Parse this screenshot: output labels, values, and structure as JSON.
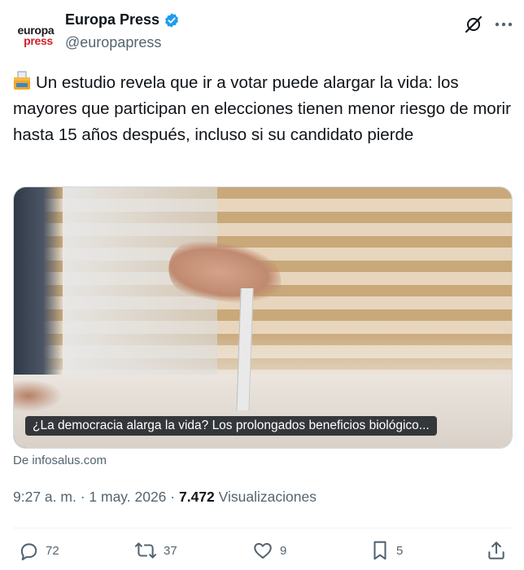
{
  "author": {
    "display_name": "Europa Press",
    "handle": "@europapress",
    "avatar_line1": "europa",
    "avatar_line2": "press",
    "verified": true
  },
  "tweet": {
    "text": "Un estudio revela que ir a votar puede alargar la vida: los mayores que participan en elecciones tienen menor riesgo de morir hasta 15 años después, incluso si su candidato pierde",
    "leading_icon": "ballot-box-icon"
  },
  "media": {
    "caption": "¿La democracia alarga la vida? Los prolongados beneficios biológico..."
  },
  "source": {
    "label": "De infosalus.com"
  },
  "meta": {
    "time": "9:27 a. m.",
    "date": "1 may. 2026",
    "separator": "·",
    "views_count": "7.472",
    "views_label": "Visualizaciones"
  },
  "actions": {
    "replies": "72",
    "reposts": "37",
    "likes": "9",
    "bookmarks": "5"
  },
  "colors": {
    "text": "#0f1419",
    "secondary": "#536471",
    "verified_blue": "#1d9bf0",
    "brand_red": "#d11f2a"
  }
}
